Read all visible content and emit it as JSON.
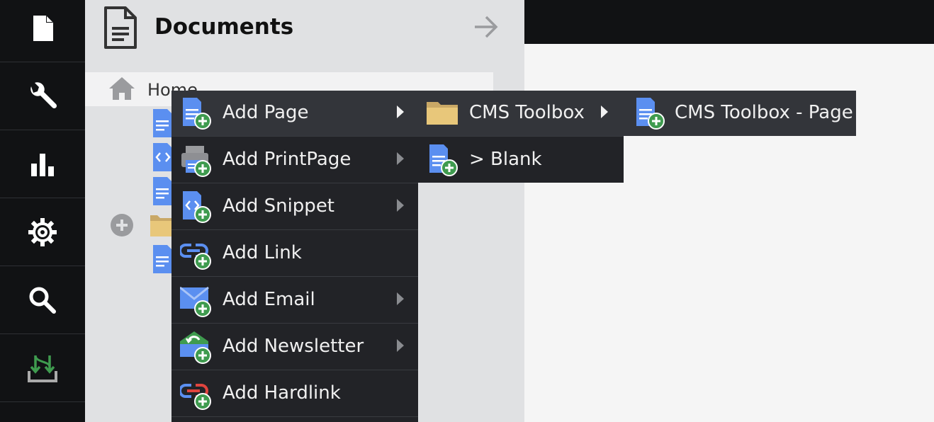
{
  "rail": {
    "items": [
      {
        "name": "document-icon"
      },
      {
        "name": "wrench-icon"
      },
      {
        "name": "bar-chart-icon"
      },
      {
        "name": "gear-icon"
      },
      {
        "name": "search-icon"
      },
      {
        "name": "data-transfer-icon"
      }
    ]
  },
  "panel": {
    "title": "Documents",
    "home_label": "Home"
  },
  "menu1": {
    "items": [
      {
        "label": "Add Page",
        "icon": "add-page-icon",
        "has_submenu": true
      },
      {
        "label": "Add PrintPage",
        "icon": "add-printpage-icon",
        "has_submenu": true
      },
      {
        "label": "Add Snippet",
        "icon": "add-snippet-icon",
        "has_submenu": true
      },
      {
        "label": "Add Link",
        "icon": "add-link-icon",
        "has_submenu": false
      },
      {
        "label": "Add Email",
        "icon": "add-email-icon",
        "has_submenu": true
      },
      {
        "label": "Add Newsletter",
        "icon": "add-newsletter-icon",
        "has_submenu": true
      },
      {
        "label": "Add Hardlink",
        "icon": "add-hardlink-icon",
        "has_submenu": false
      }
    ]
  },
  "menu2": {
    "items": [
      {
        "label": "CMS Toolbox",
        "icon": "folder-icon",
        "has_submenu": true
      },
      {
        "label": "> Blank",
        "icon": "add-page-icon",
        "has_submenu": false
      }
    ]
  },
  "menu3": {
    "items": [
      {
        "label": "CMS Toolbox - Page",
        "icon": "add-page-icon"
      }
    ]
  },
  "colors": {
    "rail_bg": "#111214",
    "panel_bg": "#e0e1e3",
    "menu_bg": "#222327",
    "menu_active_bg": "#33353a",
    "doc_blue": "#5b8ff0",
    "plus_green": "#3f9b4f",
    "folder_tan": "#e8c77a",
    "transfer_green": "#3f9b4f"
  }
}
